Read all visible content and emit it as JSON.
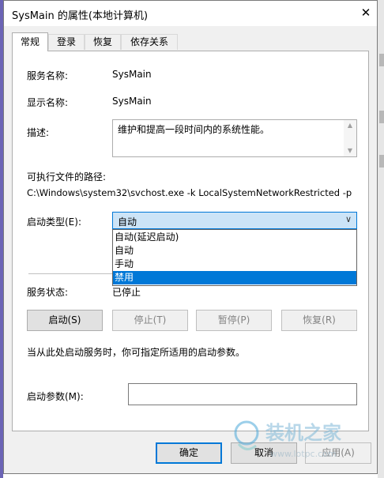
{
  "window": {
    "title": "SysMain 的属性(本地计算机)"
  },
  "tabs": [
    {
      "label": "常规",
      "active": true
    },
    {
      "label": "登录",
      "active": false
    },
    {
      "label": "恢复",
      "active": false
    },
    {
      "label": "依存关系",
      "active": false
    }
  ],
  "general": {
    "service_name_label": "服务名称:",
    "service_name_value": "SysMain",
    "display_name_label": "显示名称:",
    "display_name_value": "SysMain",
    "description_label": "描述:",
    "description_value": "维护和提高一段时间内的系统性能。",
    "exe_path_label": "可执行文件的路径:",
    "exe_path_value": "C:\\Windows\\system32\\svchost.exe -k LocalSystemNetworkRestricted -p",
    "startup_type_label": "启动类型(E):",
    "startup_type_value": "自动",
    "startup_options": [
      {
        "label": "自动(延迟启动)",
        "selected": false
      },
      {
        "label": "自动",
        "selected": false
      },
      {
        "label": "手动",
        "selected": false
      },
      {
        "label": "禁用",
        "selected": true
      }
    ],
    "status_label": "服务状态:",
    "status_value": "已停止",
    "buttons": {
      "start": "启动(S)",
      "stop": "停止(T)",
      "pause": "暂停(P)",
      "resume": "恢复(R)"
    },
    "hint_text": "当从此处启动服务时，你可指定所适用的启动参数。",
    "start_params_label": "启动参数(M):",
    "start_params_value": ""
  },
  "footer": {
    "ok": "确定",
    "cancel": "取消",
    "apply": "应用(A)"
  },
  "watermark": {
    "text": "装机之家",
    "url": "www.lotpc.com"
  },
  "colors": {
    "accent": "#0078d7",
    "select_bg": "#cce4f7",
    "dialog_bg": "#f0f0f0"
  }
}
